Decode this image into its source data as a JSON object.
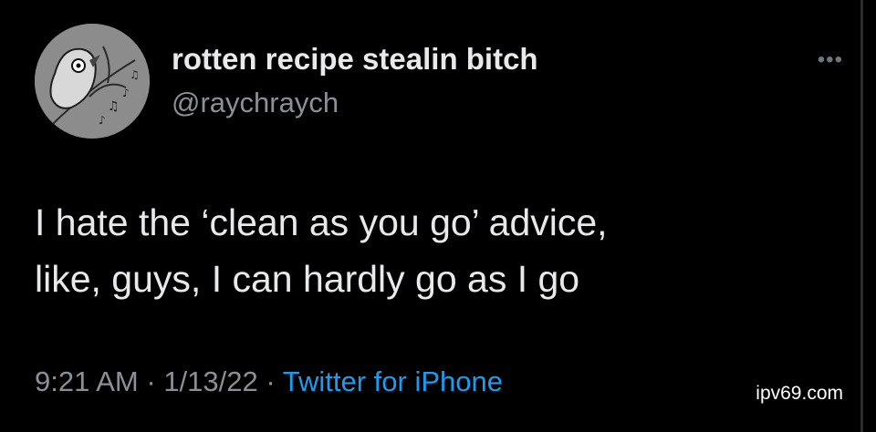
{
  "author": {
    "display_name": "rotten recipe stealin bitch",
    "handle": "@raychraych"
  },
  "more_icon": "more-icon",
  "tweet": {
    "lines": [
      "I hate the ‘clean as you go’ advice,",
      "like, guys, I can hardly go as I go"
    ]
  },
  "meta": {
    "time": "9:21 AM",
    "sep1": " · ",
    "date": "1/13/22",
    "sep2": " · ",
    "source": "Twitter for iPhone"
  },
  "watermark": "ipv69.com",
  "colors": {
    "background": "#000000",
    "text": "#e7e9ea",
    "secondary": "#8b9096",
    "link": "#1d9bf0"
  }
}
